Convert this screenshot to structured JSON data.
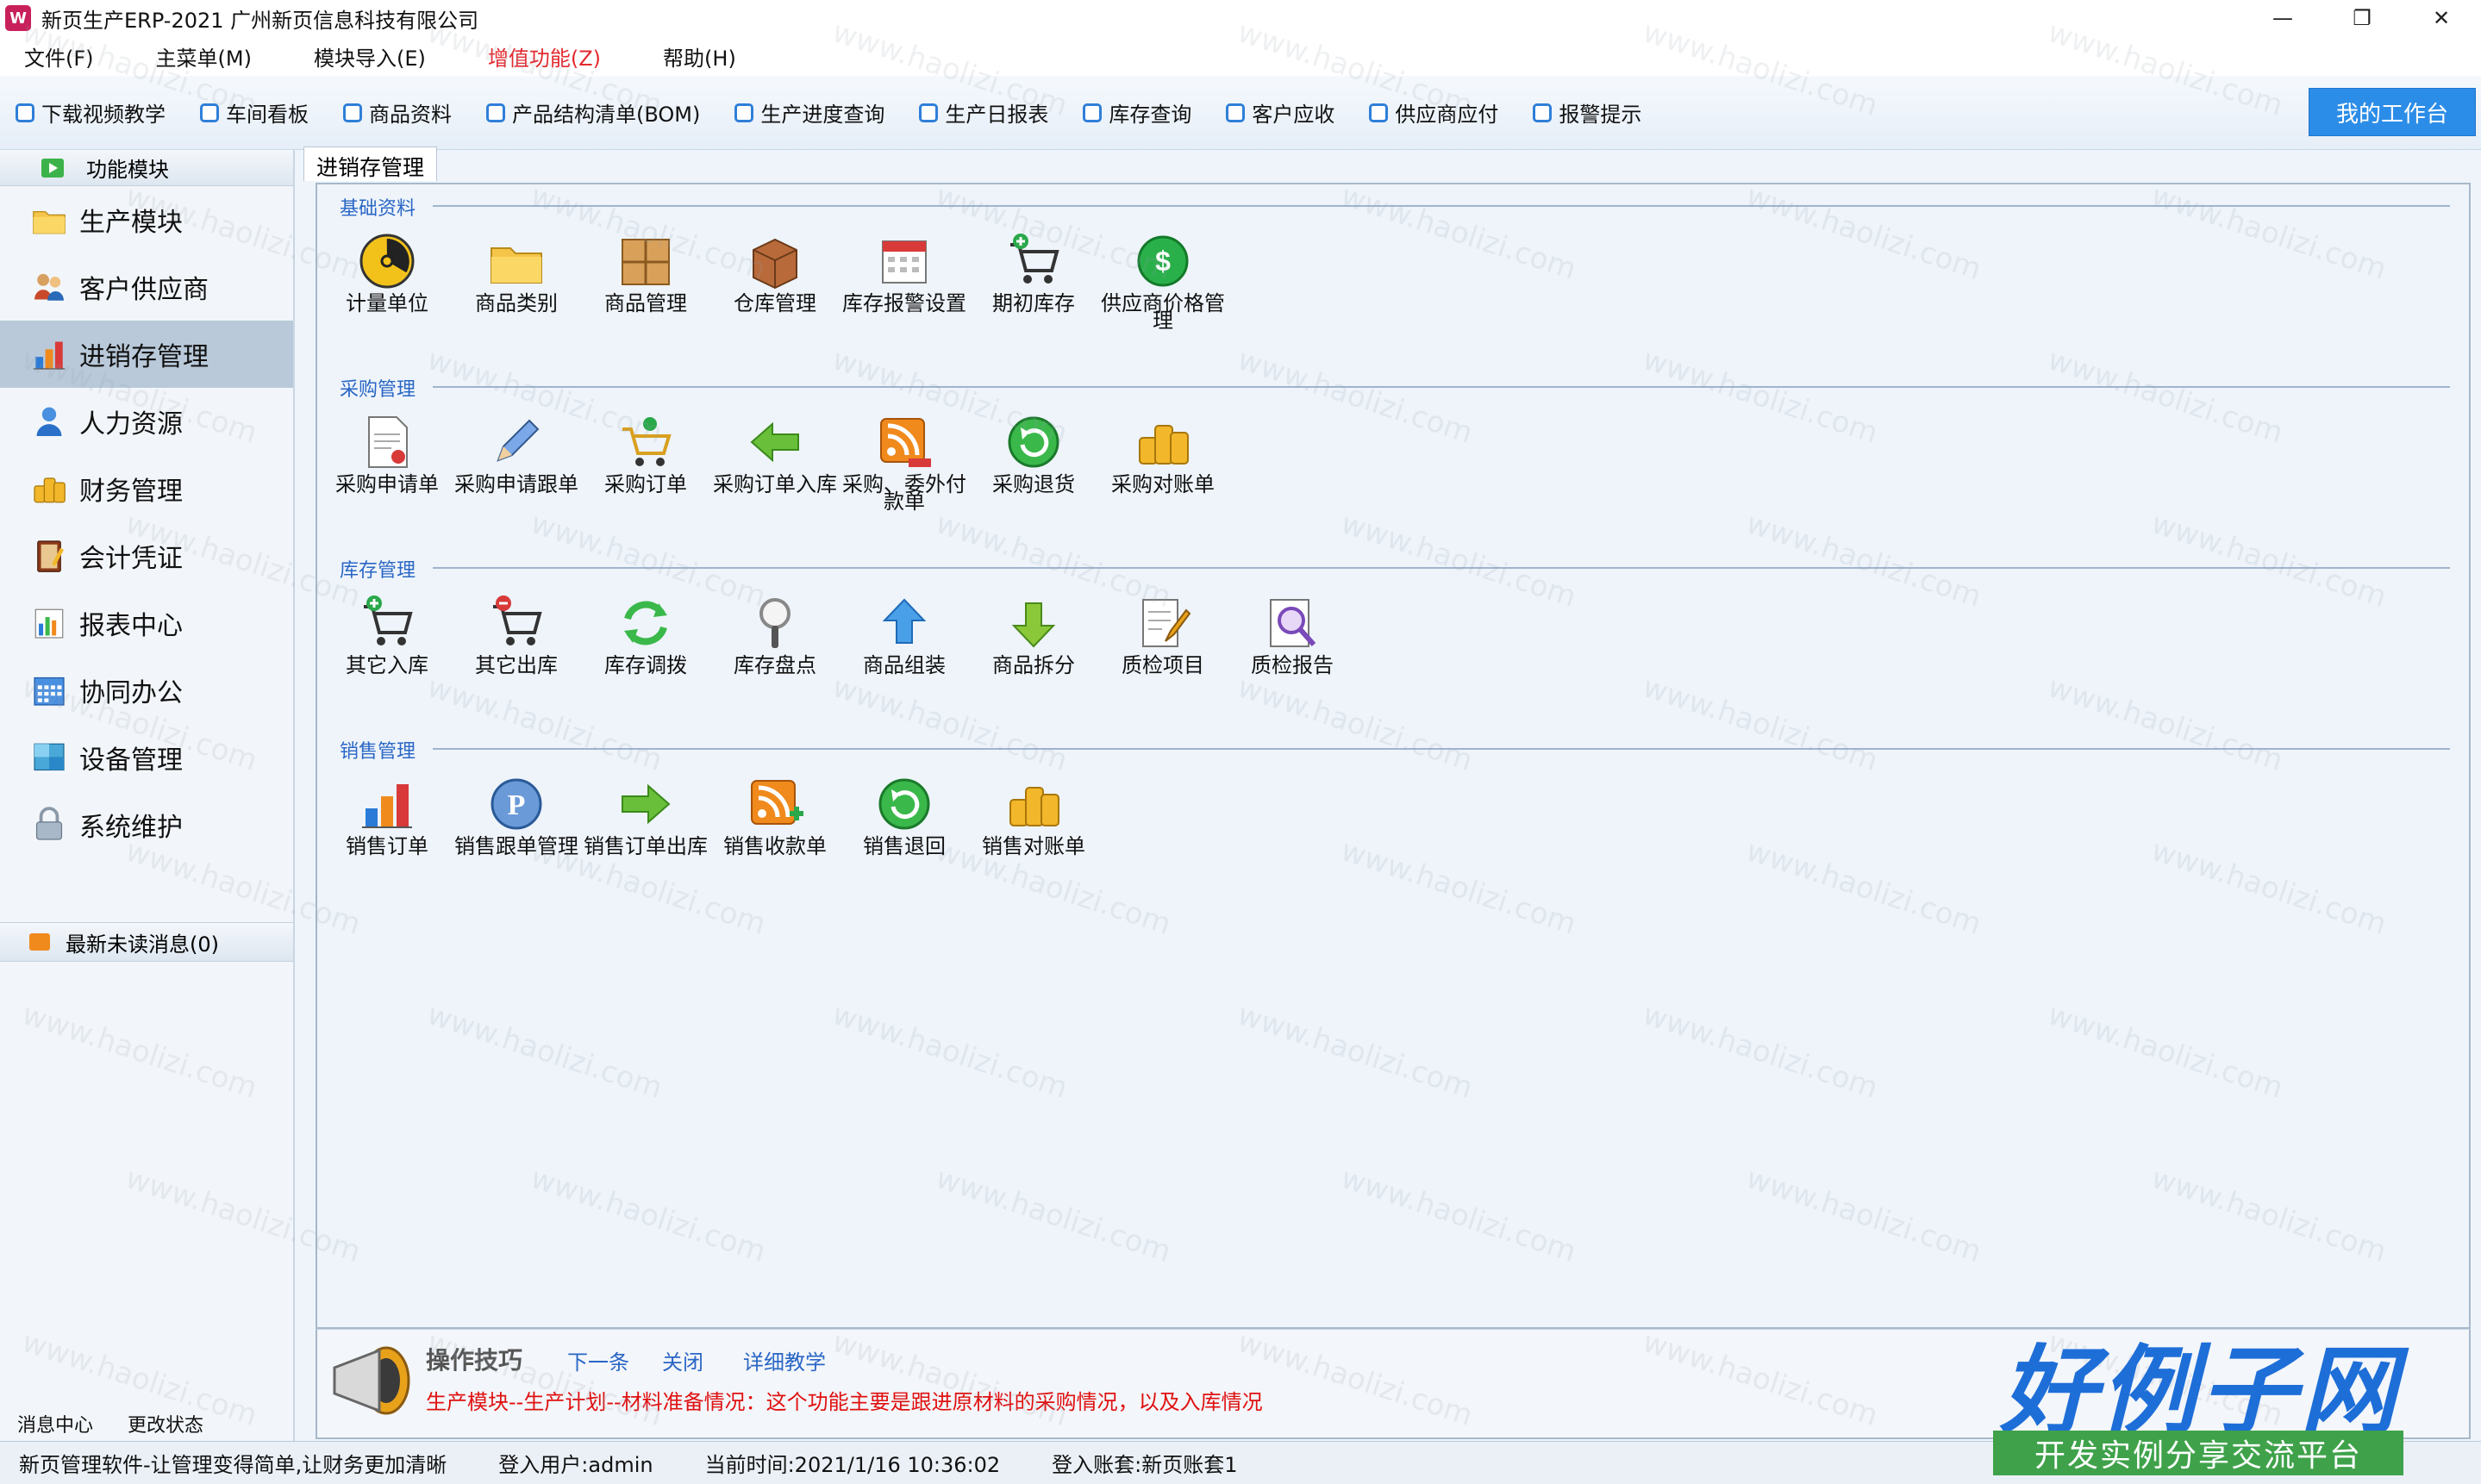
{
  "window": {
    "app_icon_glyph": "W",
    "title": "新页生产ERP-2021 广州新页信息科技有限公司",
    "minimize": "—",
    "restore": "❐",
    "close": "✕"
  },
  "menu": [
    {
      "label": "文件(F)",
      "accent": false
    },
    {
      "label": "主菜单(M)",
      "accent": false
    },
    {
      "label": "模块导入(E)",
      "accent": false
    },
    {
      "label": "增值功能(Z)",
      "accent": true
    },
    {
      "label": "帮助(H)",
      "accent": false
    }
  ],
  "quickbar": {
    "items": [
      "下载视频教学",
      "车间看板",
      "商品资料",
      "产品结构清单(BOM)",
      "生产进度查询",
      "生产日报表",
      "库存查询",
      "客户应收",
      "供应商应付",
      "报警提示"
    ],
    "workbench": "我的工作台"
  },
  "sidebar": {
    "header": "功能模块",
    "items": [
      {
        "label": "生产模块",
        "icon": "folder-icon",
        "active": false
      },
      {
        "label": "客户供应商",
        "icon": "contacts-icon",
        "active": false
      },
      {
        "label": "进销存管理",
        "icon": "bar-chart-icon",
        "active": true
      },
      {
        "label": "人力资源",
        "icon": "person-icon",
        "active": false
      },
      {
        "label": "财务管理",
        "icon": "coins-icon",
        "active": false
      },
      {
        "label": "会计凭证",
        "icon": "ledger-icon",
        "active": false
      },
      {
        "label": "报表中心",
        "icon": "report-icon",
        "active": false
      },
      {
        "label": "协同办公",
        "icon": "calendar-icon",
        "active": false
      },
      {
        "label": "设备管理",
        "icon": "device-icon",
        "active": false
      },
      {
        "label": "系统维护",
        "icon": "lock-icon",
        "active": false
      }
    ],
    "messages": "最新未读消息(0)",
    "bottom_links": [
      "消息中心",
      "更改状态"
    ]
  },
  "tab": {
    "label": "进销存管理"
  },
  "sections": [
    {
      "title": "基础资料",
      "items": [
        {
          "label": "计量单位",
          "icon": "radiation-icon"
        },
        {
          "label": "商品类别",
          "icon": "folder-icon"
        },
        {
          "label": "商品管理",
          "icon": "box-icon"
        },
        {
          "label": "仓库管理",
          "icon": "crate-icon"
        },
        {
          "label": "库存报警设置",
          "icon": "calendar-alert-icon"
        },
        {
          "label": "期初库存",
          "icon": "cart-add-icon"
        },
        {
          "label": "供应商价格管理",
          "icon": "dollar-icon"
        }
      ]
    },
    {
      "title": "采购管理",
      "items": [
        {
          "label": "采购申请单",
          "icon": "document-icon"
        },
        {
          "label": "采购申请跟单",
          "icon": "pencil-icon"
        },
        {
          "label": "采购订单",
          "icon": "cart-icon"
        },
        {
          "label": "采购订单入库",
          "icon": "arrow-left-icon"
        },
        {
          "label": "采购、委外付款单",
          "icon": "rss-icon"
        },
        {
          "label": "采购退货",
          "icon": "refresh-icon"
        },
        {
          "label": "采购对账单",
          "icon": "coins-icon"
        }
      ]
    },
    {
      "title": "库存管理",
      "items": [
        {
          "label": "其它入库",
          "icon": "cart-add-icon"
        },
        {
          "label": "其它出库",
          "icon": "cart-remove-icon"
        },
        {
          "label": "库存调拨",
          "icon": "sync-icon"
        },
        {
          "label": "库存盘点",
          "icon": "magnifier-icon"
        },
        {
          "label": "商品组装",
          "icon": "arrow-up-icon"
        },
        {
          "label": "商品拆分",
          "icon": "arrow-down-icon"
        },
        {
          "label": "质检项目",
          "icon": "edit-icon"
        },
        {
          "label": "质检报告",
          "icon": "inspect-icon"
        }
      ]
    },
    {
      "title": "销售管理",
      "items": [
        {
          "label": "销售订单",
          "icon": "bar-chart-icon"
        },
        {
          "label": "销售跟单管理",
          "icon": "p-badge-icon"
        },
        {
          "label": "销售订单出库",
          "icon": "arrow-right-icon"
        },
        {
          "label": "销售收款单",
          "icon": "rss-add-icon"
        },
        {
          "label": "销售退回",
          "icon": "refresh-icon"
        },
        {
          "label": "销售对账单",
          "icon": "coins-icon"
        }
      ]
    }
  ],
  "tips": {
    "title": "操作技巧",
    "links": [
      "下一条",
      "关闭",
      "详细教学"
    ],
    "text": "生产模块--生产计划--材料准备情况：这个功能主要是跟进原材料的采购情况，以及入库情况"
  },
  "status": [
    "新页管理软件-让管理变得简单,让财务更加清晰",
    "登入用户:admin",
    "当前时间:2021/1/16 10:36:02",
    "登入账套:新页账套1"
  ],
  "watermark": "www.haolizi.com",
  "logo": {
    "main": "好例子网",
    "sub": "开发实例分享交流平台"
  },
  "colors": {
    "accent_blue": "#2c8de8",
    "link_blue": "#2a66c5",
    "tip_red": "#e01010",
    "menu_red": "#e3292f",
    "active_item": "#b9c9d9"
  }
}
